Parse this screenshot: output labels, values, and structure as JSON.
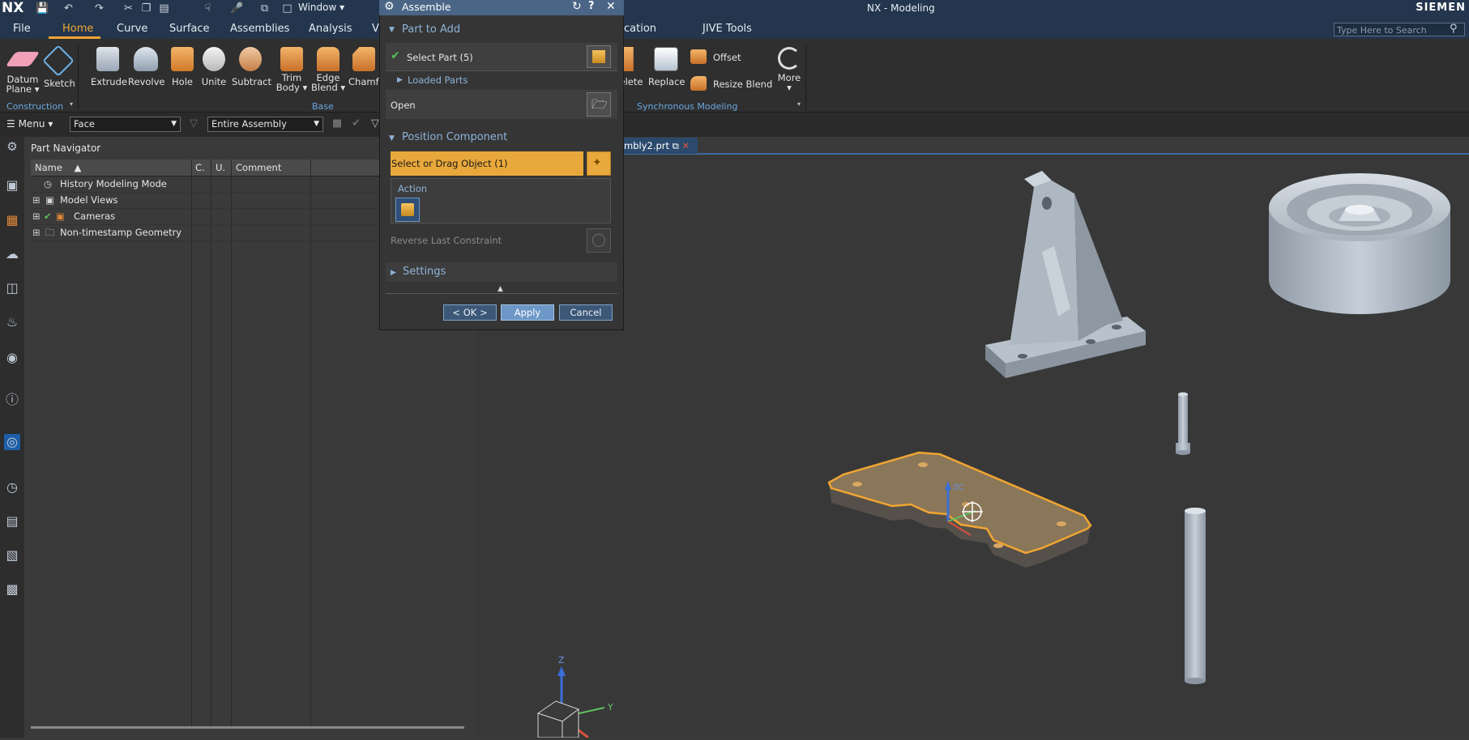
{
  "titlebar": {
    "logo": "NX",
    "window_menu": "Window",
    "app_title": "NX - Modeling",
    "brand": "SIEMEN"
  },
  "ribbon_tabs": [
    "File",
    "Home",
    "Curve",
    "Surface",
    "Assemblies",
    "Analysis",
    "V",
    "cation",
    "JIVE Tools"
  ],
  "search": {
    "placeholder": "Type Here to Search"
  },
  "ribbon": {
    "tools": [
      {
        "label": "Datum\nPlane",
        "icon": "datum-plane-icon"
      },
      {
        "label": "Sketch",
        "icon": "sketch-icon"
      },
      {
        "label": "Extrude",
        "icon": "extrude-icon"
      },
      {
        "label": "Revolve",
        "icon": "revolve-icon"
      },
      {
        "label": "Hole",
        "icon": "hole-icon"
      },
      {
        "label": "Unite",
        "icon": "unite-icon"
      },
      {
        "label": "Subtract",
        "icon": "subtract-icon"
      },
      {
        "label": "Trim\nBody",
        "icon": "trim-body-icon"
      },
      {
        "label": "Edge\nBlend",
        "icon": "edge-blend-icon"
      },
      {
        "label": "Chamfe",
        "icon": "chamfer-icon"
      }
    ],
    "sync_tools": {
      "delete": "elete",
      "replace": "Replace",
      "offset": "Offset",
      "resize_blend": "Resize Blend",
      "more": "More"
    },
    "groups": {
      "construction": "Construction",
      "base": "Base",
      "synchronous": "Synchronous Modeling"
    }
  },
  "selection_bar": {
    "menu": "Menu",
    "filter": "Face",
    "scope": "Entire Assembly"
  },
  "navigator": {
    "title": "Part Navigator",
    "columns": [
      "Name",
      "C.",
      "U.",
      "Comment"
    ],
    "rows": [
      "History Modeling Mode",
      "Model Views",
      "Cameras",
      "Non-timestamp Geometry"
    ]
  },
  "graphics": {
    "tab_label": "mbly2.prt",
    "axis_z": "Z",
    "axis_y": "Y",
    "handle_label": "ZC"
  },
  "dialog": {
    "title": "Assemble",
    "part_to_add": "Part to Add",
    "select_part": "Select Part (5)",
    "loaded_parts": "Loaded Parts",
    "open": "Open",
    "position_component": "Position Component",
    "select_or_drag": "Select or Drag Object (1)",
    "action": "Action",
    "reverse_last": "Reverse Last Constraint",
    "settings": "Settings",
    "ok": "< OK >",
    "apply": "Apply",
    "cancel": "Cancel"
  },
  "colors": {
    "accent": "#f0a533",
    "title_bar": "#23364d",
    "dialog_title": "#4a6585",
    "selection_highlight": "#e9a83b"
  }
}
